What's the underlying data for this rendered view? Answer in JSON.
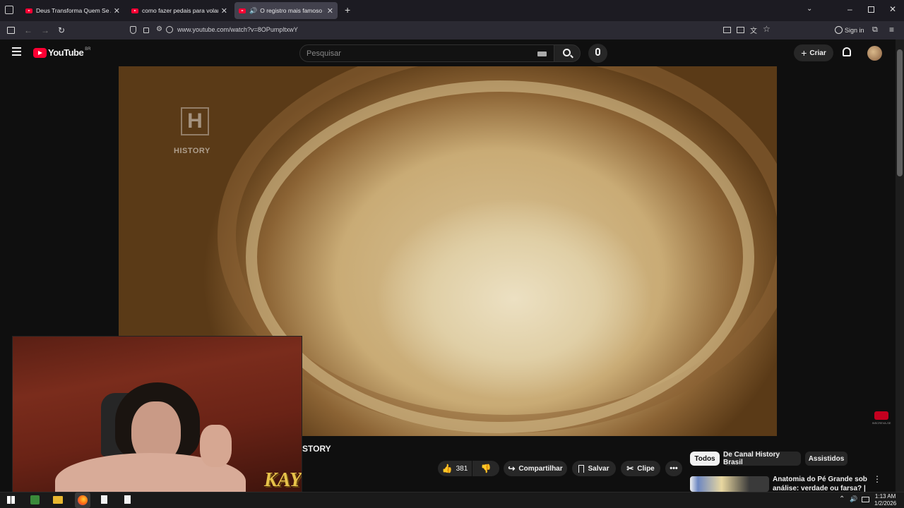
{
  "browser": {
    "tabs": [
      {
        "title": "Deus Transforma Quem Se Arre",
        "active": false
      },
      {
        "title": "como fazer pedais para volante",
        "active": false
      },
      {
        "title": "O registro mais famoso do",
        "active": true
      }
    ],
    "new_tab": "+",
    "url": "www.youtube.com/watch?v=8OPumpltxwY",
    "sign_in": "Sign in"
  },
  "youtube": {
    "logo_text": "YouTube",
    "region": "BR",
    "search_placeholder": "Pesquisar",
    "create_label": "Criar",
    "video_watermark": "HISTORY",
    "channel_fragment": "STORY",
    "actions": {
      "like_count": "381",
      "share": "Compartilhar",
      "save": "Salvar",
      "clip": "Clipe"
    },
    "filter_chips": [
      {
        "label": "Todos",
        "selected": true
      },
      {
        "label": "De Canal History Brasil",
        "selected": false
      },
      {
        "label": "Assistidos",
        "selected": false
      }
    ],
    "recommendation": {
      "title_line1": "Anatomia do Pé Grande sob",
      "title_line2": "análise: verdade ou farsa? |"
    },
    "end_badge": "INSCREVA-SE"
  },
  "webcam": {
    "overlay_text": "KAY"
  },
  "taskbar": {
    "time": "1:13 AM",
    "date": "1/2/2026"
  },
  "colors": {
    "yt_red": "#ff0033",
    "bg": "#0f0f0f",
    "chip_selected": "#f1f1f1"
  }
}
